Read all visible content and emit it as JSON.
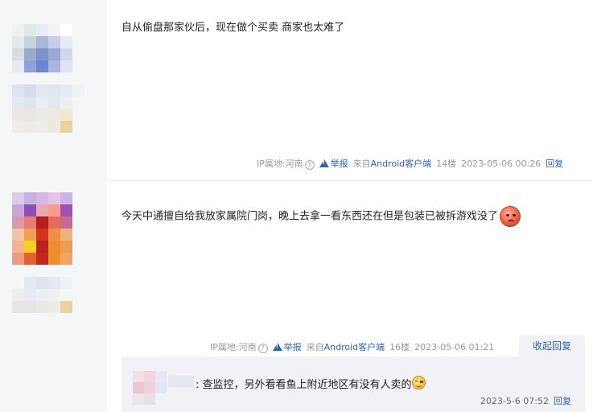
{
  "posts": [
    {
      "text": "自从偷盘那家伙后，现在做个买卖 商家也太难了",
      "ip_label": "IP属地:河南",
      "report": "举报",
      "source_prefix": "来自",
      "source_client": "Android客户端",
      "floor": "14楼",
      "datetime": "2023-05-06 00:26",
      "reply": "回复"
    },
    {
      "text": "今天中通擅自给我放家属院门岗，晚上去拿一看东西还在但是包装已被拆游戏没了",
      "ip_label": "IP属地:河南",
      "report": "举报",
      "source_prefix": "来自",
      "source_client": "Android客户端",
      "floor": "16楼",
      "datetime": "2023-05-06 01:21",
      "collapse_reply": "收起回复"
    }
  ],
  "subreply": {
    "text": ": 查监控，另外看看鱼上附近地区有没有人卖的",
    "datetime": "2023-5-6 07:52",
    "reply": "回复"
  },
  "icons": {
    "question": "?",
    "emoji_angry": "angry-face-emoji",
    "emoji_smirk": "smirk-face-emoji",
    "warning": "warning-icon"
  },
  "colors": {
    "link": "#2d64b3",
    "meta": "#999999",
    "sidebar": "#f5f6f8"
  }
}
